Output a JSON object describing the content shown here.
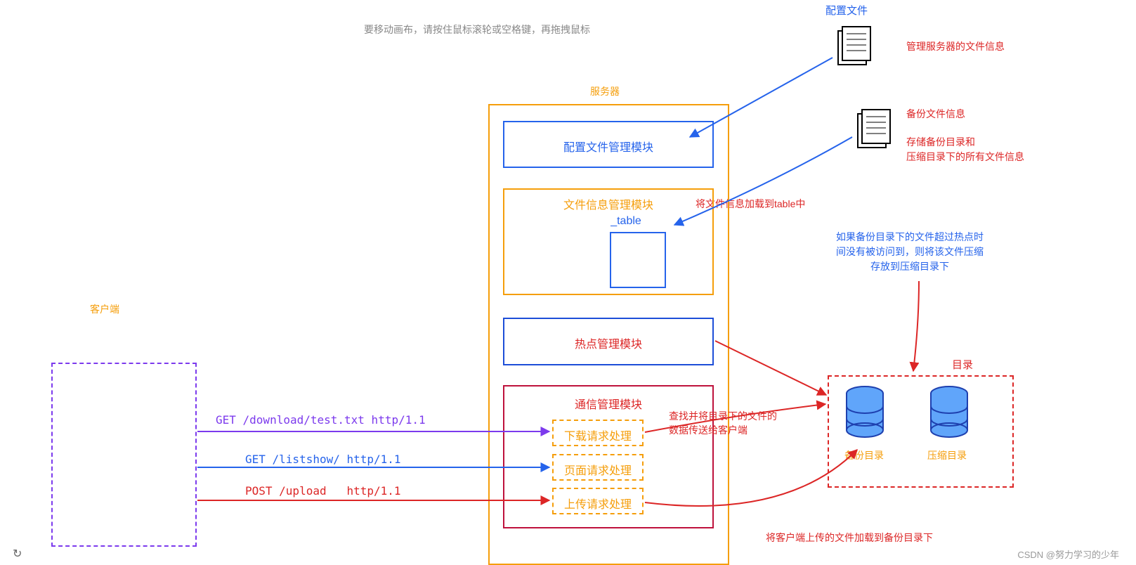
{
  "hint": "要移动画布，请按住鼠标滚轮或空格键，再拖拽鼠标",
  "configFileTitle": "配置文件",
  "configFileNote": "管理服务器的文件信息",
  "backupInfoTitle": "备份文件信息",
  "backupInfoNote": "存储备份目录和\n压缩目录下的所有文件信息",
  "loadTableNote": "将文件信息加载到table中",
  "hotspotNote": "如果备份目录下的文件超过热点时\n间没有被访问到，则将该文件压缩\n存放到压缩目录下",
  "serverTitle": "服务器",
  "clientTitle": "客户端",
  "configModule": "配置文件管理模块",
  "fileInfoModule": "文件信息管理模块",
  "tableLabel": "_table",
  "hotspotModule": "热点管理模块",
  "commModule": "通信管理模块",
  "downloadHandler": "下载请求处理",
  "pageHandler": "页面请求处理",
  "uploadHandler": "上传请求处理",
  "getDownload": "GET /download/test.txt http/1.1",
  "getListshow": "GET /listshow/ http/1.1",
  "postUpload": "POST /upload   http/1.1",
  "dirTitle": "目录",
  "backupDir": "备份目录",
  "compressDir": "压缩目录",
  "findNote": "查找并将目录下的文件的\n数据传送给客户端",
  "uploadNote": "将客户端上传的文件加载到备份目录下",
  "watermark": "CSDN @努力学习的少年"
}
